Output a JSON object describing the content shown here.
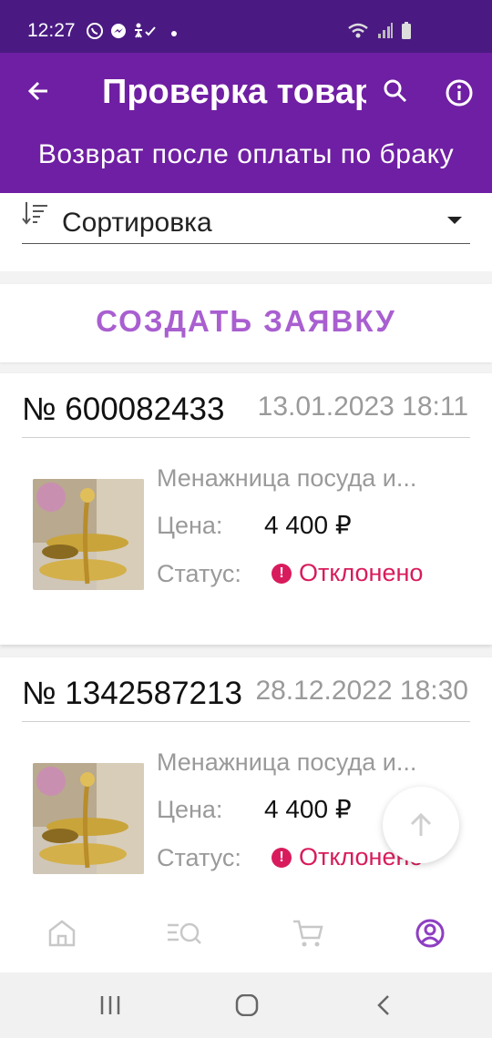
{
  "status_bar": {
    "time": "12:27"
  },
  "app_bar": {
    "title": "Проверка товара",
    "subtitle": "Возврат после оплаты по браку"
  },
  "sort": {
    "label": "Сортировка"
  },
  "create": {
    "label": "СОЗДАТЬ ЗАЯВКУ"
  },
  "orders": [
    {
      "number": "№ 600082433",
      "date": "13.01.2023 18:11",
      "name": "Менажница посуда и...",
      "price_label": "Цена:",
      "price": "4 400 ₽",
      "status_label": "Статус:",
      "status": "Отклонено"
    },
    {
      "number": "№ 1342587213",
      "date": "28.12.2022 18:30",
      "name": "Менажница посуда и...",
      "price_label": "Цена:",
      "price": "4 400 ₽",
      "status_label": "Статус:",
      "status": "Отклонено"
    }
  ],
  "colors": {
    "appbar": "#6f1fa3",
    "statusbar": "#4a1a82",
    "accent": "#a95fd0",
    "rejected": "#d81b5c"
  },
  "bottom_nav": [
    {
      "icon": "home-icon"
    },
    {
      "icon": "catalog-search-icon"
    },
    {
      "icon": "cart-icon"
    },
    {
      "icon": "profile-icon",
      "active": true
    }
  ]
}
